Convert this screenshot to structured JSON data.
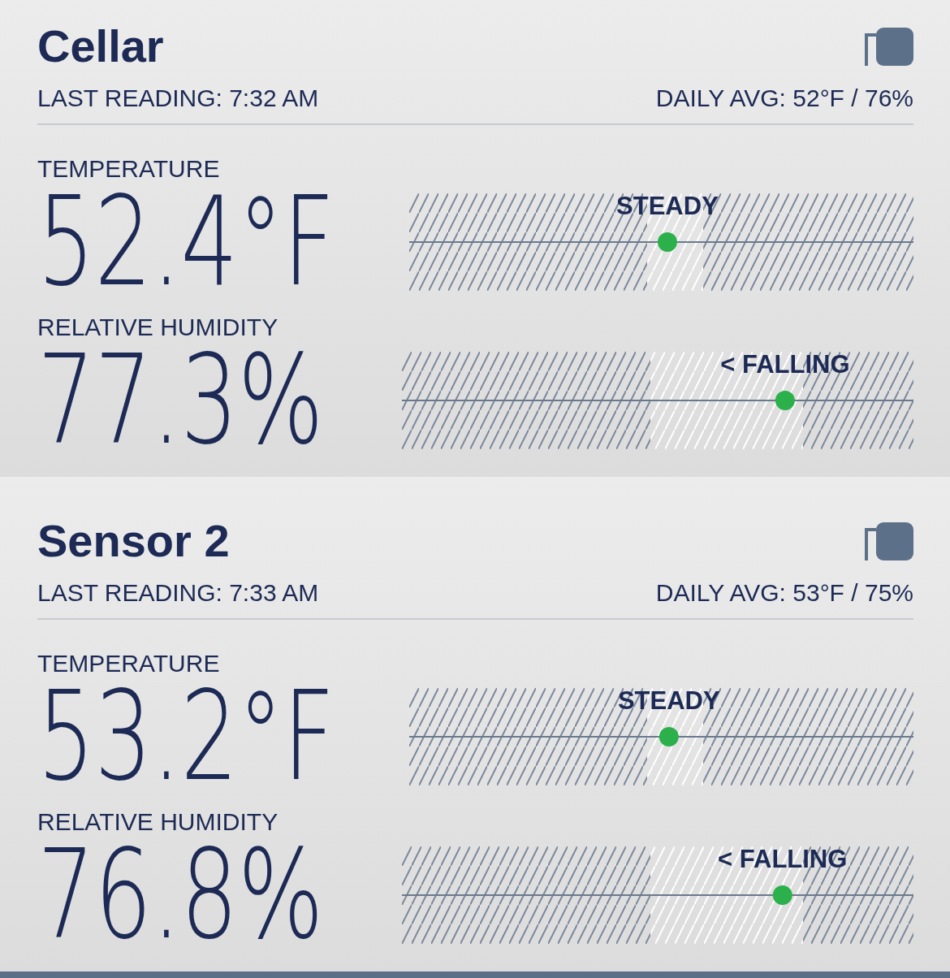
{
  "sensors": [
    {
      "name": "Cellar",
      "last_reading": "LAST READING: 7:32 AM",
      "daily_avg": "DAILY AVG: 52°F / 76%",
      "metrics": [
        {
          "kind": "temperature",
          "label": "TEMPERATURE",
          "value": "52.4°F",
          "trend": "STEADY",
          "level": 0.512
        },
        {
          "kind": "humidity",
          "label": "RELATIVE HUMIDITY",
          "value": "77.3%",
          "trend": "< FALLING",
          "level": 0.749
        }
      ]
    },
    {
      "name": "Sensor 2",
      "last_reading": "LAST READING: 7:33 AM",
      "daily_avg": "DAILY AVG: 53°F / 75%",
      "metrics": [
        {
          "kind": "temperature",
          "label": "TEMPERATURE",
          "value": "53.2°F",
          "trend": "STEADY",
          "level": 0.515
        },
        {
          "kind": "humidity",
          "label": "RELATIVE HUMIDITY",
          "value": "76.8%",
          "trend": "< FALLING",
          "level": 0.744
        }
      ]
    }
  ]
}
